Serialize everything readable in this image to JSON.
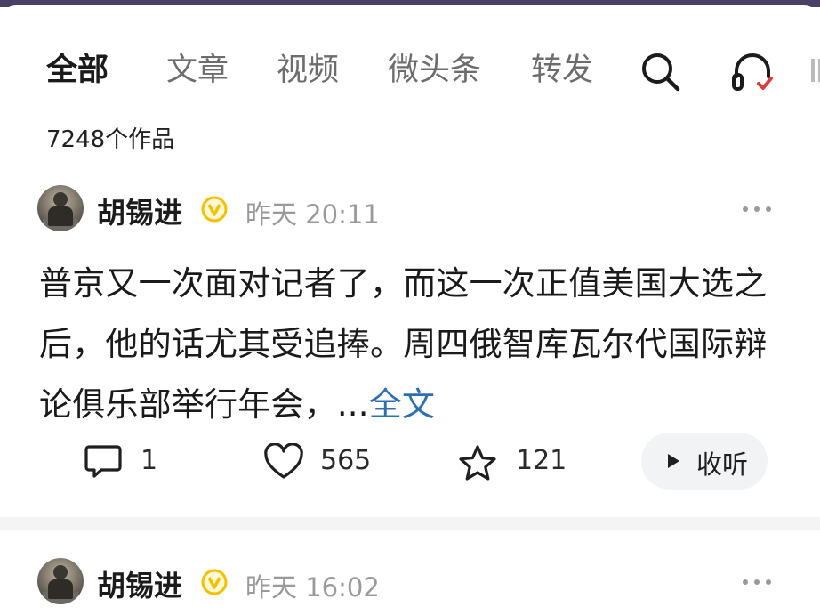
{
  "tabs": [
    {
      "label": "全部",
      "active": true
    },
    {
      "label": "文章",
      "active": false
    },
    {
      "label": "视频",
      "active": false
    },
    {
      "label": "微头条",
      "active": false
    },
    {
      "label": "转发",
      "active": false
    }
  ],
  "toolbar": {
    "search_icon": "search-icon",
    "listen_icon": "headset-icon",
    "more_icon": "more-icon"
  },
  "works_count": "7248个作品",
  "posts": [
    {
      "author": "胡锡进",
      "badge": "verified-v-badge",
      "day": "昨天",
      "time": "20:11",
      "text": "普京又一次面对记者了，而这一次正值美国大选之后，他的话尤其受追捧。周四俄智库瓦尔代国际辩论俱乐部举行年会，",
      "ellipsis": "...",
      "full_link": "全文",
      "comments": "1",
      "likes": "565",
      "favorites": "121",
      "listen_label": "收听"
    },
    {
      "author": "胡锡进",
      "badge": "verified-v-badge",
      "day": "昨天",
      "time": "16:02"
    }
  ],
  "colors": {
    "accent_link": "#2e6fb0",
    "badge": "#f2c200",
    "topbar": "#4b3f66"
  }
}
